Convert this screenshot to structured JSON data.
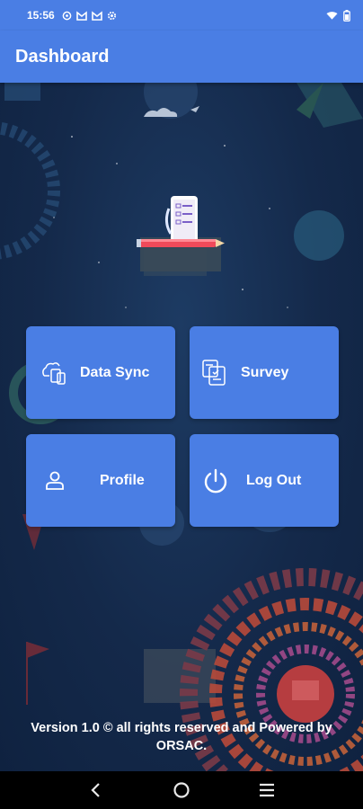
{
  "status_bar": {
    "time": "15:56",
    "notification_icons": [
      "sync-icon",
      "mail-icon",
      "mail-icon",
      "settings-icon"
    ],
    "right_icons": [
      "wifi-icon",
      "battery-icon"
    ]
  },
  "app_bar": {
    "title": "Dashboard"
  },
  "tiles": [
    {
      "id": "data-sync",
      "label": "Data Sync",
      "icon": "cloud-sync-icon"
    },
    {
      "id": "survey",
      "label": "Survey",
      "icon": "survey-form-icon"
    },
    {
      "id": "profile",
      "label": "Profile",
      "icon": "person-icon"
    },
    {
      "id": "log-out",
      "label": "Log Out",
      "icon": "power-icon"
    }
  ],
  "footer": {
    "text": "Version 1.0 © all rights reserved and Powered by ORSAC."
  },
  "colors": {
    "primary": "#4a7ee4",
    "background": "#14294a",
    "nav_bar": "#000000"
  },
  "nav_bar": {
    "buttons": [
      "back-icon",
      "home-icon",
      "recents-icon"
    ]
  }
}
